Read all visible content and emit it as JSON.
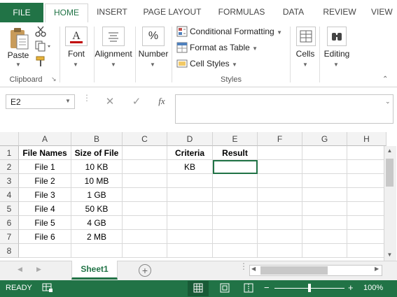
{
  "ribbon_tabs": [
    "FILE",
    "HOME",
    "INSERT",
    "PAGE LAYOUT",
    "FORMULAS",
    "DATA",
    "REVIEW",
    "VIEW"
  ],
  "active_tab": "HOME",
  "clipboard": {
    "paste_label": "Paste",
    "group_label": "Clipboard"
  },
  "font": {
    "label": "Font"
  },
  "alignment": {
    "label": "Alignment"
  },
  "number": {
    "label": "Number"
  },
  "styles": {
    "conditional_formatting": "Conditional Formatting",
    "format_as_table": "Format as Table",
    "cell_styles": "Cell Styles",
    "group_label": "Styles"
  },
  "cells": {
    "label": "Cells"
  },
  "editing": {
    "label": "Editing"
  },
  "formula_bar": {
    "name_box": "E2",
    "cancel_glyph": "✕",
    "enter_glyph": "✓",
    "fx_label": "fx",
    "content": ""
  },
  "grid": {
    "columns": [
      "A",
      "B",
      "C",
      "D",
      "E",
      "F",
      "G",
      "H"
    ],
    "rows": [
      "1",
      "2",
      "3",
      "4",
      "5",
      "6",
      "7",
      "8"
    ],
    "cells": {
      "A1": "File Names",
      "B1": "Size of File",
      "D1": "Criteria",
      "E1": "Result",
      "A2": "File 1",
      "B2": "10 KB",
      "D2": "KB",
      "A3": "File 2",
      "B3": "10 MB",
      "A4": "File 3",
      "B4": "1 GB",
      "A5": "File 4",
      "B5": "50 KB",
      "A6": "File 5",
      "B6": "4 GB",
      "A7": "File 6",
      "B7": "2 MB"
    },
    "selected_cell": "E2"
  },
  "sheets": {
    "active": "Sheet1"
  },
  "status": {
    "mode": "READY",
    "zoom": "100%",
    "zoom_minus": "−",
    "zoom_plus": "+"
  },
  "colors": {
    "accent": "#217346"
  }
}
